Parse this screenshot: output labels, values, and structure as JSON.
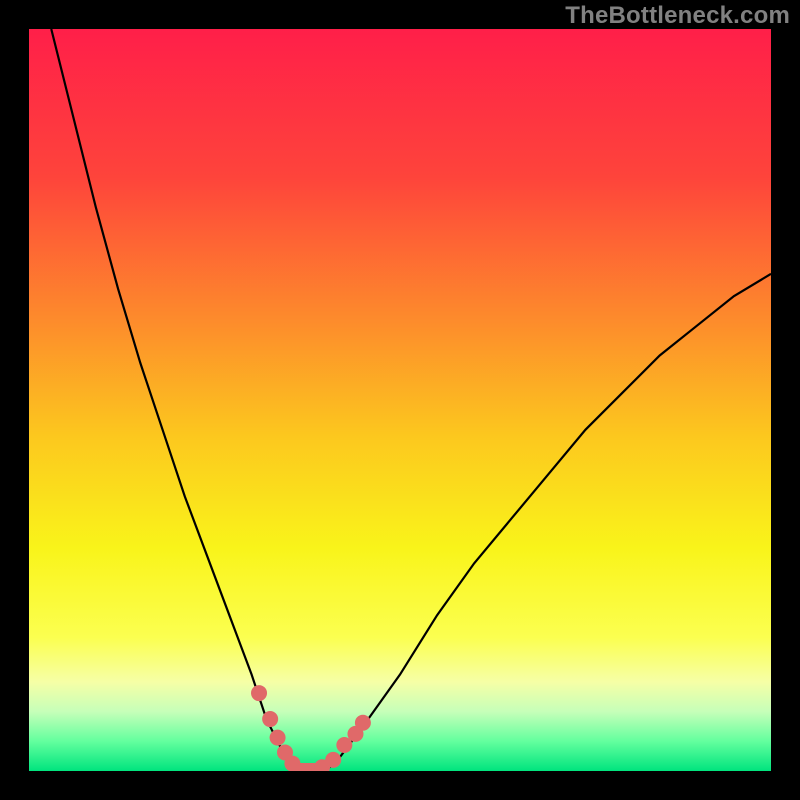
{
  "watermark": "TheBottleneck.com",
  "chart_data": {
    "type": "line",
    "title": "",
    "xlabel": "",
    "ylabel": "",
    "xlim": [
      0,
      100
    ],
    "ylim": [
      0,
      100
    ],
    "grid": false,
    "legend": false,
    "background_gradient": {
      "description": "vertical gradient behind curve, top to bottom",
      "stops": [
        {
          "pos": 0.0,
          "color": "#ff1f49"
        },
        {
          "pos": 0.2,
          "color": "#fe443b"
        },
        {
          "pos": 0.4,
          "color": "#fd8e2b"
        },
        {
          "pos": 0.55,
          "color": "#fcc81e"
        },
        {
          "pos": 0.7,
          "color": "#f9f41a"
        },
        {
          "pos": 0.82,
          "color": "#fbff50"
        },
        {
          "pos": 0.88,
          "color": "#f6ffa6"
        },
        {
          "pos": 0.92,
          "color": "#c6ffb9"
        },
        {
          "pos": 0.96,
          "color": "#63ff9e"
        },
        {
          "pos": 1.0,
          "color": "#00e47e"
        }
      ]
    },
    "series": [
      {
        "name": "bottleneck-curve",
        "note": "y ~ bottleneck percentage; dips to 0 near x~37; values estimated from pixel positions",
        "x": [
          3,
          6,
          9,
          12,
          15,
          18,
          21,
          24,
          27,
          30,
          32,
          34,
          36,
          38,
          40,
          42,
          45,
          50,
          55,
          60,
          65,
          70,
          75,
          80,
          85,
          90,
          95,
          100
        ],
        "y": [
          100,
          88,
          76,
          65,
          55,
          46,
          37,
          29,
          21,
          13,
          7,
          3,
          0,
          0,
          0,
          2,
          6,
          13,
          21,
          28,
          34,
          40,
          46,
          51,
          56,
          60,
          64,
          67
        ]
      }
    ],
    "highlight_points": {
      "note": "salmon dots on curve near the trough",
      "x": [
        31.0,
        32.5,
        33.5,
        34.5,
        35.5,
        39.5,
        41.0,
        42.5,
        44.0,
        45.0
      ],
      "y": [
        10.5,
        7.0,
        4.5,
        2.5,
        1.0,
        0.5,
        1.5,
        3.5,
        5.0,
        6.5
      ],
      "color": "#e06969",
      "radius_px": 8
    },
    "flat_segment": {
      "note": "salmon flat line at y=0 between curve branches",
      "x0": 35.5,
      "x1": 40.0,
      "y": 0,
      "color": "#e06969",
      "thickness_px": 12
    }
  }
}
